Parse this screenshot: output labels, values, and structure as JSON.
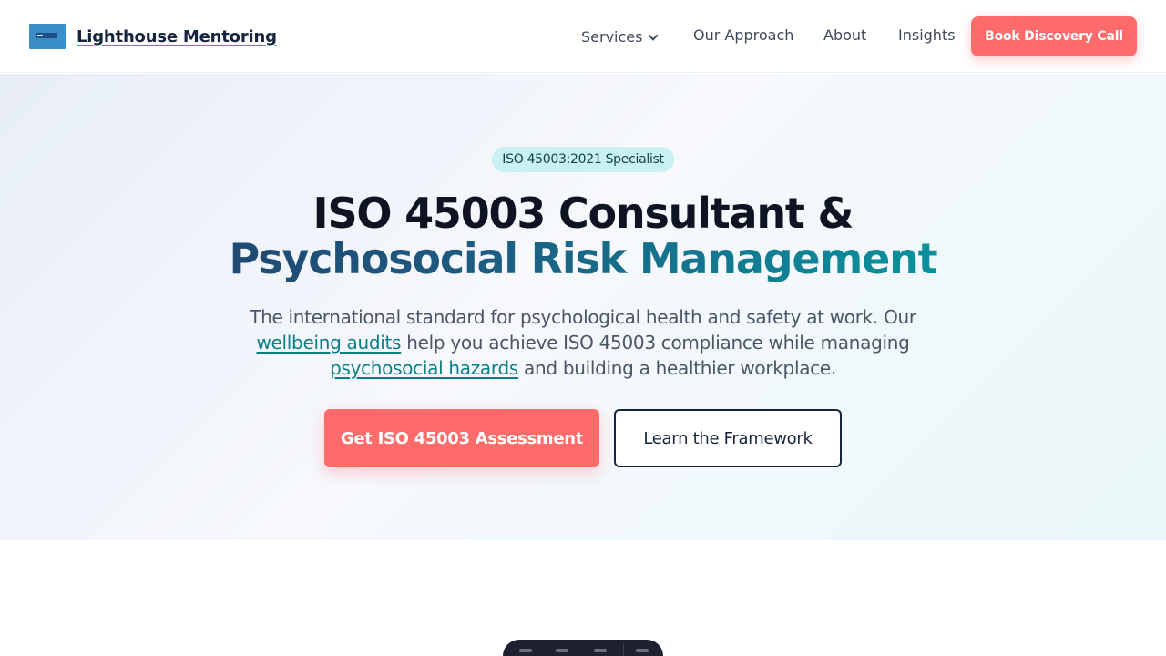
{
  "brand": {
    "name": "Lighthouse Mentoring",
    "logo_icon": "lighthouse-logo"
  },
  "nav": {
    "items": [
      {
        "label": "Services",
        "has_dropdown": true
      },
      {
        "label": "Our Approach"
      },
      {
        "label": "About"
      },
      {
        "label": "Insights"
      }
    ],
    "cta_label": "Book Discovery Call"
  },
  "hero": {
    "badge": "ISO 45003:2021 Specialist",
    "title_line1": "ISO 45003 Consultant &",
    "title_line2": "Psychosocial Risk Management",
    "subtitle_part1": "The international standard for psychological health and safety at work. Our ",
    "subtitle_link1": "wellbeing audits",
    "subtitle_part2": " help you achieve ISO 45003 compliance while managing ",
    "subtitle_link2": "psychosocial hazards",
    "subtitle_part3": " and building a healthier workplace.",
    "primary_button": "Get ISO 45003 Assessment",
    "secondary_button": "Learn the Framework"
  },
  "colors": {
    "accent": "#ff6b6b",
    "navy": "#16253d",
    "teal": "#0aa0aa",
    "badge_bg": "#c9f1f1"
  }
}
